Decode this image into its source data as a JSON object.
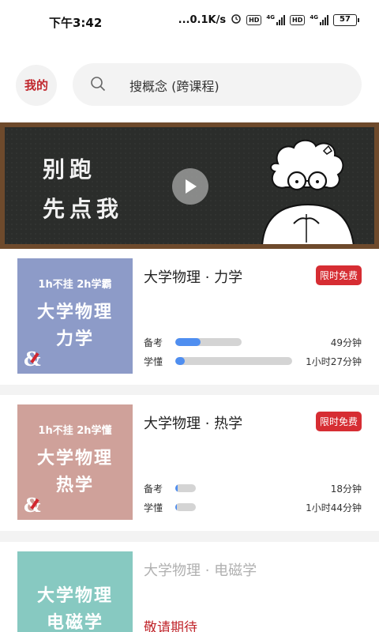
{
  "status_bar": {
    "time": "下午3:42",
    "network_speed": "...0.1K/s",
    "sim1": "4G",
    "sim2": "4G",
    "hd": "HD",
    "battery": "57"
  },
  "header": {
    "my_label": "我的",
    "search_placeholder": "搜概念 (跨课程)"
  },
  "banner": {
    "line1": "别跑",
    "line2": "先点我"
  },
  "courses": [
    {
      "cover_subtitle": "1h不挂 2h学霸",
      "cover_title_line1": "大学物理",
      "cover_title_line2": "力学",
      "cover_color": "#8d9bc8",
      "title": "大学物理 · 力学",
      "badge": "限时免费",
      "rows": [
        {
          "label": "备考",
          "time": "49分钟",
          "progress": 0.38
        },
        {
          "label": "学懂",
          "time": "1小时27分钟",
          "progress": 0.08
        }
      ]
    },
    {
      "cover_subtitle": "1h不挂 2h学懂",
      "cover_title_line1": "大学物理",
      "cover_title_line2": "热学",
      "cover_color": "#cfa19a",
      "title": "大学物理 · 热学",
      "badge": "限时免费",
      "rows": [
        {
          "label": "备考",
          "time": "18分钟",
          "progress": 0.1
        },
        {
          "label": "学懂",
          "time": "1小时44分钟",
          "progress": 0.07
        }
      ]
    },
    {
      "cover_title_line1": "大学物理",
      "cover_title_line2": "电磁学",
      "cover_color": "#87c9c1",
      "title": "大学物理 · 电磁学",
      "status": "敬请期待"
    }
  ],
  "colors": {
    "accent_red": "#d62d33",
    "progress_blue": "#4f8ef0"
  }
}
